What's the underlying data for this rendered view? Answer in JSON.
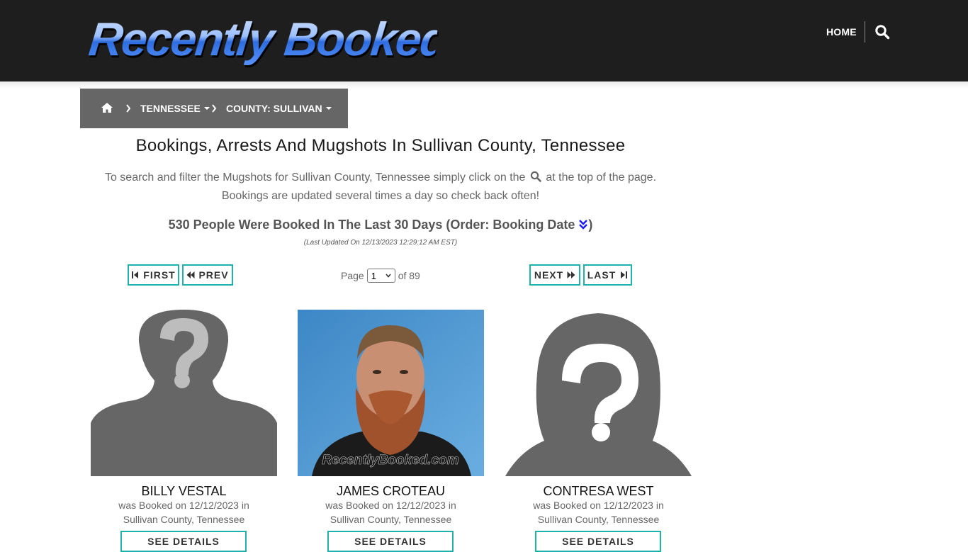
{
  "header": {
    "logo_text": "Recently Booked",
    "nav_home": "HOME",
    "search_icon": "search-icon"
  },
  "breadcrumb": {
    "home_icon": "home-icon",
    "state": "TENNESSEE",
    "county": "COUNTY: SULLIVAN"
  },
  "main": {
    "title": "Bookings, Arrests And Mugshots In Sullivan County, Tennessee",
    "intro_before": "To search and filter the Mugshots for Sullivan County, Tennessee simply click on the",
    "intro_after": "at the top of the page.",
    "intro_line2": "Bookings are updated several times a day so check back often!",
    "count_text": "530 People Were Booked In The Last 30 Days (Order: Booking Date",
    "count_close": ")",
    "last_updated": "(Last Updated On 12/13/2023 12:29:12 AM EST)"
  },
  "pagination": {
    "first": "FIRST",
    "prev": "PREV",
    "next": "NEXT",
    "last": "LAST",
    "page_label": "Page",
    "current_page": "1",
    "of_label": "of 89"
  },
  "cards": [
    {
      "name": "BILLY VESTAL",
      "line1": "was Booked on 12/12/2023 in",
      "line2": "Sullivan County, Tennessee",
      "button": "SEE DETAILS",
      "photo": "male-placeholder-silhouette"
    },
    {
      "name": "JAMES CROTEAU",
      "line1": "was Booked on 12/12/2023 in",
      "line2": "Sullivan County, Tennessee",
      "button": "SEE DETAILS",
      "photo": "mugshot-photo",
      "watermark": "RecentlyBooked.com"
    },
    {
      "name": "CONTRESA WEST",
      "line1": "was Booked on 12/12/2023 in",
      "line2": "Sullivan County, Tennessee",
      "button": "SEE DETAILS",
      "photo": "female-placeholder-silhouette"
    }
  ],
  "colors": {
    "header_bg": "#1e1e1e",
    "breadcrumb_bg": "#666666",
    "button_border": "#20b2aa",
    "placeholder_gray": "#666666",
    "mugshot_bg": "#4a90c8"
  }
}
